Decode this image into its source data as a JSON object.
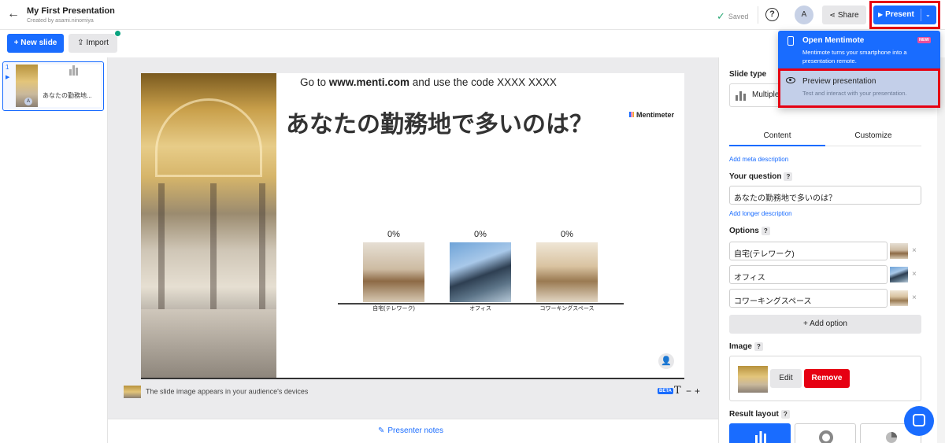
{
  "header": {
    "title": "My First Presentation",
    "subtitle": "Created by asami.ninomiya",
    "saved_label": "Saved",
    "help_label": "?",
    "avatar_initial": "A",
    "share_label": "Share",
    "present_label": "Present"
  },
  "toolbar": {
    "new_slide_label": "+ New slide",
    "import_label": "Import"
  },
  "slides_list": [
    {
      "number": "1",
      "title": "あなたの勤務地..."
    }
  ],
  "slide": {
    "join_prefix": "Go to ",
    "join_url": "www.menti.com",
    "join_mid": " and use the code ",
    "join_code": "XXXX XXXX",
    "question": "あなたの勤務地で多いのは？",
    "brand": "Mentimeter",
    "options": [
      {
        "pct": "0%",
        "label": "自宅(テレワーク)"
      },
      {
        "pct": "0%",
        "label": "オフィス"
      },
      {
        "pct": "0%",
        "label": "コワーキングスペース"
      }
    ]
  },
  "canvas_footer": {
    "image_note": "The slide image appears in your audience's devices",
    "beta_label": "BETA",
    "text_size_label": "T",
    "minus_label": "−",
    "plus_label": "+",
    "presenter_notes_label": "Presenter notes"
  },
  "right_panel": {
    "slide_type_label": "Slide type",
    "slide_type_value": "Multiple",
    "tabs": [
      {
        "label": "Content"
      },
      {
        "label": "Customize"
      }
    ],
    "add_meta_description": "Add meta description",
    "your_question_label": "Your question",
    "question_value": "あなたの勤務地で多いのは？",
    "add_longer_description": "Add longer description",
    "options_label": "Options",
    "option_values": [
      "自宅(テレワーク)",
      "オフィス",
      "コワーキングスペース"
    ],
    "add_option_label": "+ Add option",
    "image_label": "Image",
    "edit_label": "Edit",
    "remove_label": "Remove",
    "result_layout_label": "Result layout",
    "help_mark": "?",
    "remove_mark": "×"
  },
  "present_menu": {
    "items": [
      {
        "title": "Open Mentimote",
        "badge": "NEW",
        "description": "Mentimote turns your smartphone into a presentation remote."
      },
      {
        "title": "Preview presentation",
        "description": "Test and interact with your presentation."
      }
    ]
  },
  "colors": {
    "accent": "#196cff",
    "highlight_frame": "#e60012",
    "remove_button": "#e60012",
    "saved_check": "#2aa876"
  }
}
